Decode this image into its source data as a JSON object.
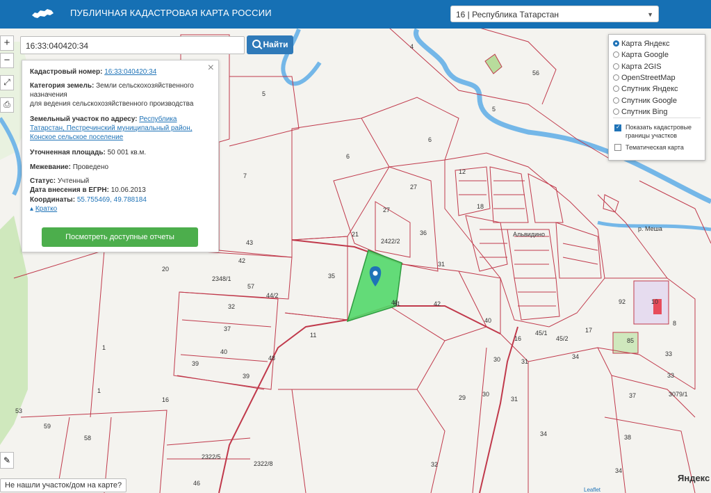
{
  "header": {
    "title": "ПУБЛИЧНАЯ КАДАСТРОВАЯ КАРТА РОССИИ",
    "region_select": "16 | Республика Татарстан"
  },
  "map_controls": {
    "zoom_in": "+",
    "zoom_out": "−"
  },
  "search": {
    "value": "16:33:040420:34",
    "button_label": "Найти"
  },
  "info": {
    "cad_label": "Кадастровый номер:",
    "cad_value": "16:33:040420:34",
    "category_label": "Категория земель:",
    "category_value": "Земли сельскохозяйственного назначения",
    "category_value2": "для ведения сельскохозяйственного производства",
    "address_label": "Земельный участок по адресу:",
    "address_value": "Республика Татарстан, Пестречинский муниципальный район, Конское сельское поселение",
    "area_label": "Уточненная площадь:",
    "area_value": "50 001 кв.м.",
    "survey_label": "Межевание:",
    "survey_value": "Проведено",
    "status_label": "Статус:",
    "status_value": "Учтенный",
    "date_label": "Дата внесения в ЕГРН:",
    "date_value": "10.06.2013",
    "coord_label": "Координаты:",
    "coord_value": "55.755469, 49.788184",
    "brief_label": "Кратко",
    "reports_button": "Посмотреть доступные отчеты"
  },
  "layers": {
    "options": [
      {
        "label": "Карта Яндекс",
        "selected": true
      },
      {
        "label": "Карта Google",
        "selected": false
      },
      {
        "label": "Карта 2GIS",
        "selected": false
      },
      {
        "label": "OpenStreetMap",
        "selected": false
      },
      {
        "label": "Спутник Яндекс",
        "selected": false
      },
      {
        "label": "Спутник Google",
        "selected": false
      },
      {
        "label": "Спутник Bing",
        "selected": false
      }
    ],
    "show_borders": "Показать кадастровые границы участков",
    "show_borders_checked": true,
    "thematic": "Тематическая карта",
    "thematic_checked": false
  },
  "map": {
    "village_label": "Альвидино",
    "river_label": "р. Меша",
    "parcel_labels": [
      "4",
      "56",
      "5",
      "5",
      "6",
      "6",
      "7",
      "27",
      "27",
      "12",
      "18",
      "36",
      "21",
      "2422/2",
      "43",
      "42",
      "2348/1",
      "57",
      "44/2",
      "35",
      "31",
      "32",
      "37",
      "40",
      "39",
      "39",
      "11",
      "1",
      "1",
      "16",
      "48",
      "42",
      "41",
      "40",
      "16",
      "45/1",
      "45/2",
      "17",
      "34",
      "31",
      "29",
      "30",
      "31",
      "30",
      "34",
      "92",
      "10",
      "85",
      "8",
      "33",
      "37",
      "33",
      "3079/1",
      "38",
      "34",
      "32",
      "46",
      "2322/5",
      "2322/8",
      "59",
      "58",
      "53",
      "20",
      "81"
    ]
  },
  "footer": {
    "not_found": "Не нашли участок/дом на карте?",
    "yandex_logo": "Яндекс",
    "leaflet": "Leaflet"
  },
  "colors": {
    "header": "#1670b4",
    "parcel_line": "#c0394b",
    "selected_parcel": "#53d86a",
    "river": "#74b7e8",
    "button_green": "#4cae4c"
  }
}
